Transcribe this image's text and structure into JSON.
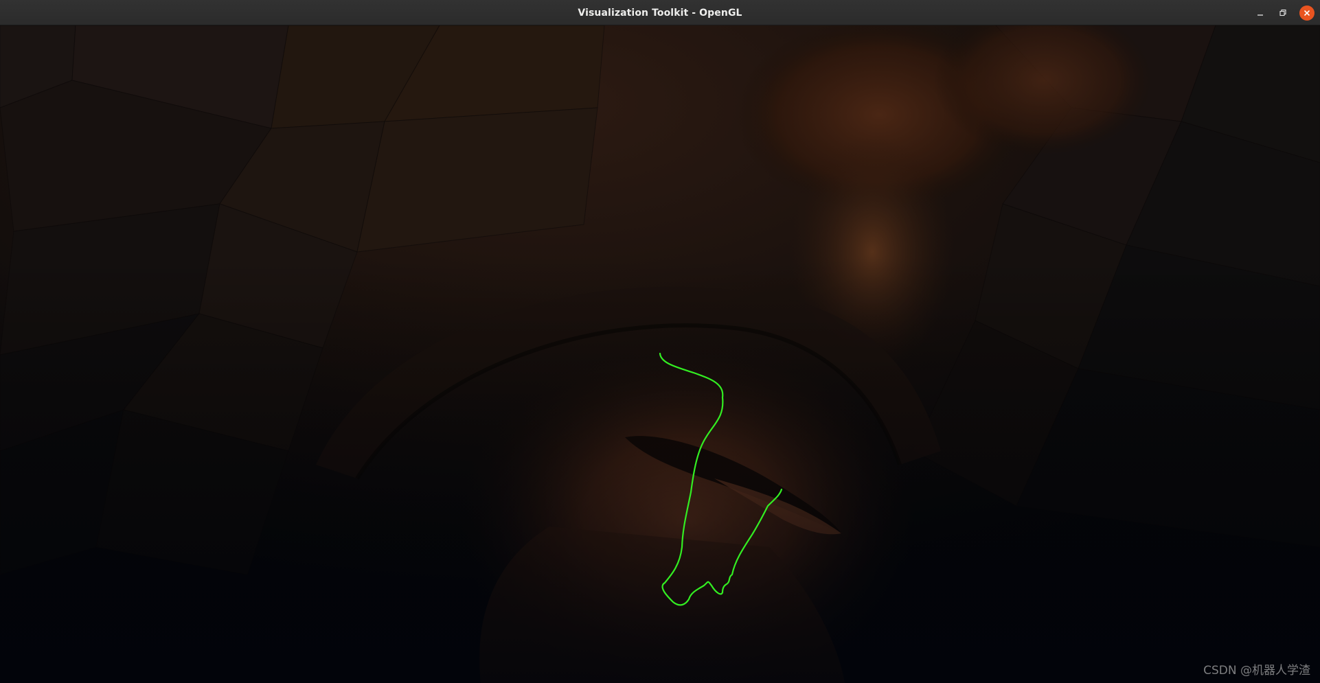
{
  "window": {
    "title": "Visualization Toolkit - OpenGL",
    "controls": {
      "minimize_icon": "minimize-icon",
      "maximize_icon": "restore-icon",
      "close_icon": "close-icon"
    }
  },
  "scene": {
    "background_color": "#06080c",
    "surface_color": "#6b3a22",
    "path_color": "#33ee22"
  },
  "watermark": {
    "text": "CSDN @机器人学渣"
  }
}
